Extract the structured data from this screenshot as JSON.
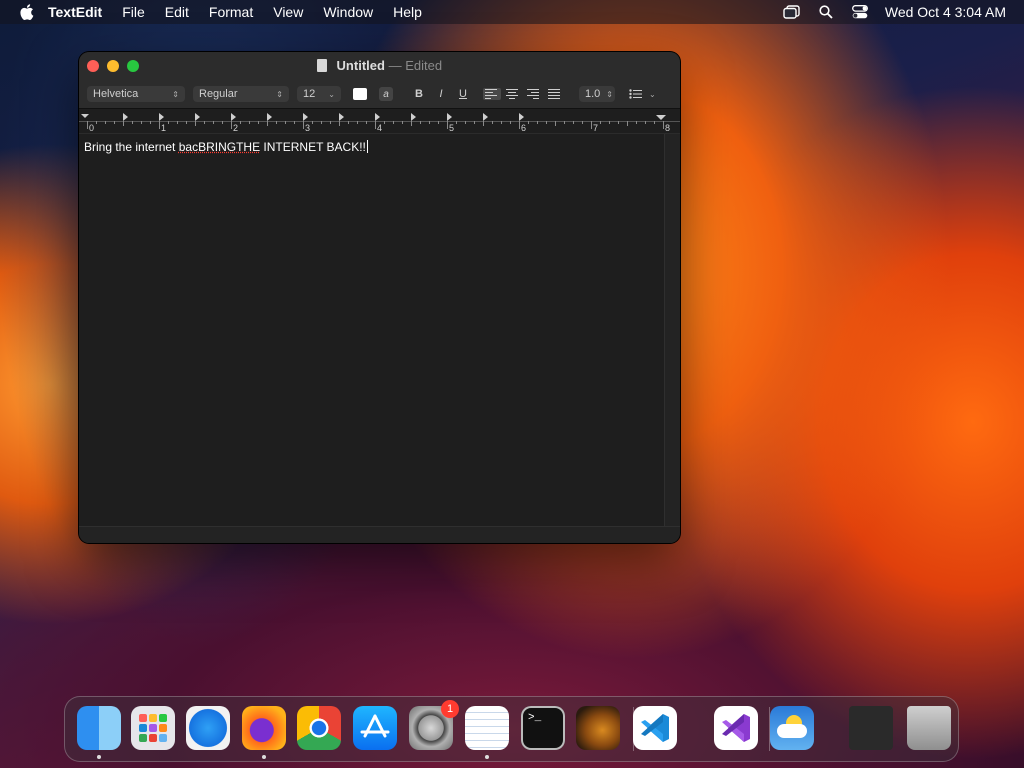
{
  "menubar": {
    "app_name": "TextEdit",
    "items": [
      "File",
      "Edit",
      "Format",
      "View",
      "Window",
      "Help"
    ],
    "clock": "Wed Oct 4  3:04 AM"
  },
  "window": {
    "title": "Untitled",
    "separator": "—",
    "status": "Edited"
  },
  "toolbar": {
    "font_family": "Helvetica",
    "font_style": "Regular",
    "font_size": "12",
    "highlight_label": "a",
    "bold_label": "B",
    "italic_label": "I",
    "underline_label": "U",
    "line_spacing": "1.0",
    "active_alignment": "left"
  },
  "ruler": {
    "labels": [
      "0",
      "1",
      "2",
      "3",
      "4",
      "5",
      "6",
      "7",
      "8"
    ]
  },
  "document": {
    "text_before": "Bring the internet ",
    "misspelled": "bacBRINGTHE",
    "text_after": " INTERNET BACK!!"
  },
  "dock": {
    "apps": [
      {
        "name": "Finder",
        "icon": "finder-icon",
        "running": true
      },
      {
        "name": "Launchpad",
        "icon": "launchpad-icon",
        "running": false
      },
      {
        "name": "Safari",
        "icon": "safari-icon",
        "running": false
      },
      {
        "name": "Firefox",
        "icon": "firefox-icon",
        "running": true
      },
      {
        "name": "Google Chrome",
        "icon": "chrome-icon",
        "running": false
      },
      {
        "name": "App Store",
        "icon": "app-store-icon",
        "running": false
      },
      {
        "name": "System Settings",
        "icon": "system-settings-icon",
        "running": false,
        "badge": "1"
      },
      {
        "name": "TextEdit",
        "icon": "textedit-icon",
        "running": true
      },
      {
        "name": "Terminal",
        "icon": "terminal-icon",
        "running": false
      },
      {
        "name": "GarageBand",
        "icon": "garageband-icon",
        "running": false
      },
      {
        "name": "Visual Studio Code",
        "icon": "vscode-icon",
        "running": false
      },
      {
        "name": "Visual Studio",
        "icon": "visual-studio-icon",
        "running": false
      },
      {
        "name": "Weather",
        "icon": "weather-icon",
        "running": false
      },
      {
        "name": "Firefox Window",
        "icon": "firefox-window-thumbnail",
        "running": false
      },
      {
        "name": "Trash",
        "icon": "trash-icon",
        "running": false
      }
    ]
  },
  "colors": {
    "close": "#ff5f57",
    "minimize": "#febc2e",
    "maximize": "#28c840",
    "badge": "#ff3b30"
  }
}
